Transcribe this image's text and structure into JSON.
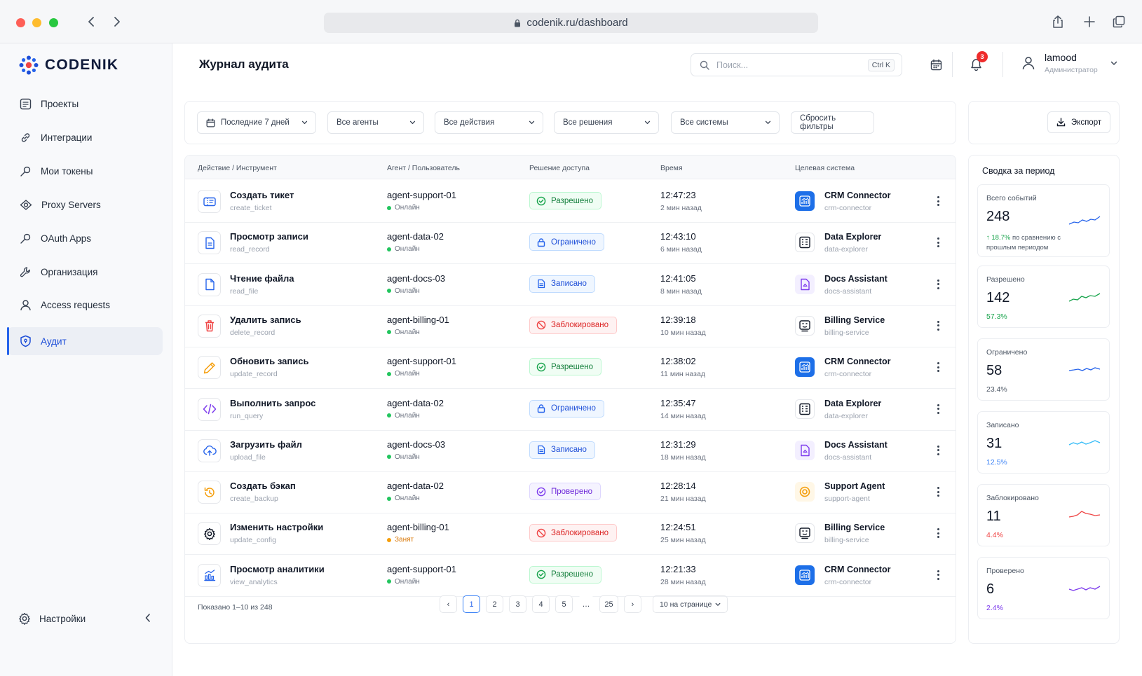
{
  "browser": {
    "url": "codenik.ru/dashboard"
  },
  "brand": {
    "name": "CODENIK"
  },
  "sidebar": {
    "items": [
      {
        "label": "Проекты",
        "icon": "projects-icon"
      },
      {
        "label": "Интеграции",
        "icon": "integrations-icon"
      },
      {
        "label": "Мои токены",
        "icon": "key-icon"
      },
      {
        "label": "Proxy Servers",
        "icon": "proxy-icon"
      },
      {
        "label": "OAuth Apps",
        "icon": "key-icon"
      },
      {
        "label": "Организация",
        "icon": "wrench-icon"
      },
      {
        "label": "Access requests",
        "icon": "user-icon"
      },
      {
        "label": "Аудит",
        "icon": "shield-icon",
        "active": true
      }
    ],
    "settings_label": "Настройки"
  },
  "header": {
    "title": "Журнал аудита",
    "search_placeholder": "Поиск...",
    "search_shortcut": "Ctrl K",
    "notifications_count": "3",
    "user_name": "lamood",
    "user_role": "Администратор"
  },
  "filters": {
    "period": "Последние 7 дней",
    "agents": "Все агенты",
    "actions": "Все действия",
    "decisions": "Все решения",
    "systems": "Все системы",
    "reset": "Сбросить фильтры",
    "export": "Экспорт"
  },
  "table": {
    "headers": [
      "Действие / Инструмент",
      "Агент / Пользователь",
      "Решение доступа",
      "Время",
      "Целевая система"
    ],
    "rows": [
      {
        "action": "Создать тикет",
        "code": "create_ticket",
        "icon": "ticket-icon",
        "agent": "agent-support-01",
        "status": "Онлайн",
        "decision": "Разрешено",
        "time": "12:47:23",
        "ago": "2 мин назад",
        "system": "CRM Connector",
        "system_code": "crm-connector",
        "sys_type": "crm"
      },
      {
        "action": "Просмотр записи",
        "code": "read_record",
        "icon": "document-icon",
        "agent": "agent-data-02",
        "status": "Онлайн",
        "decision": "Ограничено",
        "time": "12:43:10",
        "ago": "6 мин назад",
        "system": "Data Explorer",
        "system_code": "data-explorer",
        "sys_type": "data"
      },
      {
        "action": "Чтение файла",
        "code": "read_file",
        "icon": "file-icon",
        "agent": "agent-docs-03",
        "status": "Онлайн",
        "decision": "Записано",
        "time": "12:41:05",
        "ago": "8 мин назад",
        "system": "Docs Assistant",
        "system_code": "docs-assistant",
        "sys_type": "docs"
      },
      {
        "action": "Удалить запись",
        "code": "delete_record",
        "icon": "trash-icon",
        "agent": "agent-billing-01",
        "status": "Онлайн",
        "decision": "Заблокировано",
        "time": "12:39:18",
        "ago": "10 мин назад",
        "system": "Billing Service",
        "system_code": "billing-service",
        "sys_type": "billing"
      },
      {
        "action": "Обновить запись",
        "code": "update_record",
        "icon": "pencil-icon",
        "agent": "agent-support-01",
        "status": "Онлайн",
        "decision": "Разрешено",
        "time": "12:38:02",
        "ago": "11 мин назад",
        "system": "CRM Connector",
        "system_code": "crm-connector",
        "sys_type": "crm"
      },
      {
        "action": "Выполнить запрос",
        "code": "run_query",
        "icon": "code-icon",
        "agent": "agent-data-02",
        "status": "Онлайн",
        "decision": "Ограничено",
        "time": "12:35:47",
        "ago": "14 мин назад",
        "system": "Data Explorer",
        "system_code": "data-explorer",
        "sys_type": "data"
      },
      {
        "action": "Загрузить файл",
        "code": "upload_file",
        "icon": "upload-icon",
        "agent": "agent-docs-03",
        "status": "Онлайн",
        "decision": "Записано",
        "time": "12:31:29",
        "ago": "18 мин назад",
        "system": "Docs Assistant",
        "system_code": "docs-assistant",
        "sys_type": "docs"
      },
      {
        "action": "Создать бэкап",
        "code": "create_backup",
        "icon": "history-icon",
        "agent": "agent-data-02",
        "status": "Онлайн",
        "decision": "Проверено",
        "time": "12:28:14",
        "ago": "21 мин назад",
        "system": "Support Agent",
        "system_code": "support-agent",
        "sys_type": "support"
      },
      {
        "action": "Изменить настройки",
        "code": "update_config",
        "icon": "gear-icon",
        "agent": "agent-billing-01",
        "status": "Занят",
        "decision": "Заблокировано",
        "time": "12:24:51",
        "ago": "25 мин назад",
        "system": "Billing Service",
        "system_code": "billing-service",
        "sys_type": "billing"
      },
      {
        "action": "Просмотр аналитики",
        "code": "view_analytics",
        "icon": "analytics-icon",
        "agent": "agent-support-01",
        "status": "Онлайн",
        "decision": "Разрешено",
        "time": "12:21:33",
        "ago": "28 мин назад",
        "system": "CRM Connector",
        "system_code": "crm-connector",
        "sys_type": "crm"
      }
    ]
  },
  "pagination": {
    "info": "Показано 1–10 из 248",
    "pages": [
      "1",
      "2",
      "3",
      "4",
      "5",
      "…",
      "25"
    ],
    "prev": "‹",
    "next": "›",
    "per_page": "10 на странице"
  },
  "summary": {
    "title": "Сводка за период",
    "total": {
      "label": "Всего событий",
      "value": "248",
      "change": "18.7%",
      "note": "по сравнению с прошлым периодом"
    },
    "stats": [
      {
        "label": "Разрешено",
        "value": "142",
        "pct": "57.3%",
        "color": "#16a34a"
      },
      {
        "label": "Ограничено",
        "value": "58",
        "pct": "23.4%",
        "color": "#4b5563"
      },
      {
        "label": "Записано",
        "value": "31",
        "pct": "12.5%",
        "color": "#3b82f6"
      },
      {
        "label": "Заблокировано",
        "value": "11",
        "pct": "4.4%",
        "color": "#ef4444"
      },
      {
        "label": "Проверено",
        "value": "6",
        "pct": "2.4%",
        "color": "#7c3aed"
      }
    ]
  }
}
